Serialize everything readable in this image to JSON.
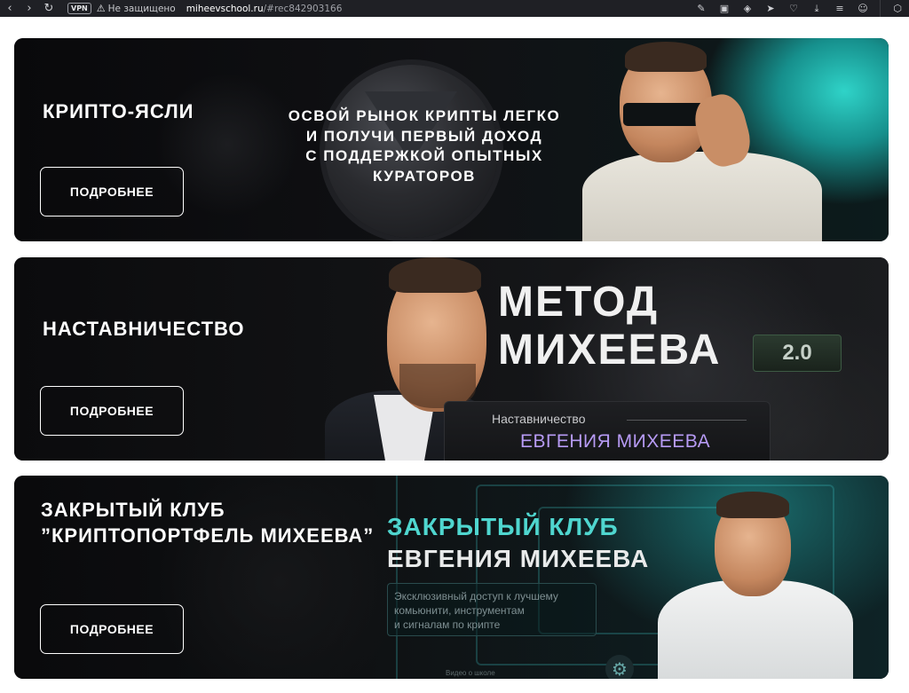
{
  "browser": {
    "vpn_label": "VPN",
    "insecure_label": "Не защищено",
    "url_host": "miheevschool.ru",
    "url_path": "/#rec842903166"
  },
  "banners": [
    {
      "title_lines": [
        "КРИПТО-ЯСЛИ"
      ],
      "button": "ПОДРОБНЕЕ",
      "slogan_lines": [
        "ОСВОЙ РЫНОК КРИПТЫ ЛЕГКО",
        "И ПОЛУЧИ ПЕРВЫЙ ДОХОД",
        "С ПОДДЕРЖКОЙ ОПЫТНЫХ",
        "КУРАТОРОВ"
      ]
    },
    {
      "title_lines": [
        "НАСТАВНИЧЕСТВО"
      ],
      "button": "ПОДРОБНЕЕ",
      "method_line1": "МЕТОД",
      "method_line2": "МИХЕЕВА",
      "version": "2.0",
      "mentor_label": "Наставничество",
      "mentor_name": "ЕВГЕНИЯ МИХЕЕВА"
    },
    {
      "title_lines": [
        "ЗАКРЫТЫЙ КЛУБ",
        "”КРИПТОПОРТФЕЛЬ МИХЕЕВА”"
      ],
      "button": "ПОДРОБНЕЕ",
      "club_line1": "ЗАКРЫТЫЙ КЛУБ",
      "club_line2": "ЕВГЕНИЯ МИХЕЕВА",
      "club_desc_lines": [
        "Эксклюзивный доступ к лучшему",
        "комьюнити, инструментам",
        "и сигналам по крипте"
      ],
      "video_label": "Видео о школе"
    }
  ]
}
